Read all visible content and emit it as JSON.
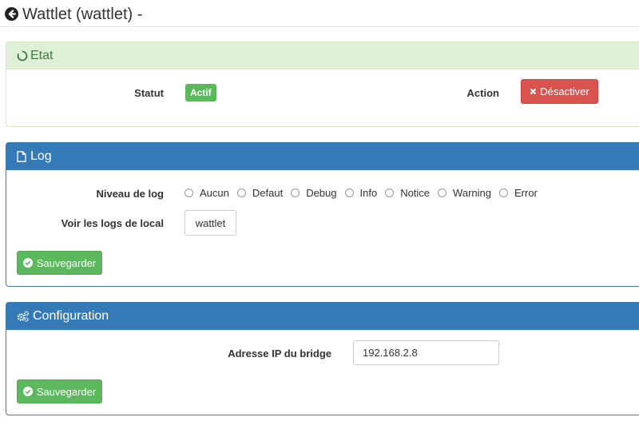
{
  "header": {
    "title": "Wattlet (wattlet) -",
    "back_icon": "arrow-circle-left-icon"
  },
  "etat": {
    "title": "Etat",
    "icon": "refresh-circle-icon",
    "statut_label": "Statut",
    "statut_value": "Actif",
    "action_label": "Action",
    "action_button": "Désactiver",
    "colors": {
      "heading_bg": "#dff0d8",
      "badge": "#5cb85c",
      "danger": "#d9534f"
    }
  },
  "log": {
    "title": "Log",
    "icon": "file-icon",
    "level_label": "Niveau de log",
    "levels": [
      "Aucun",
      "Defaut",
      "Debug",
      "Info",
      "Notice",
      "Warning",
      "Error"
    ],
    "view_label": "Voir les logs de local",
    "view_button": "wattlet",
    "save_button": "Sauvegarder"
  },
  "config": {
    "title": "Configuration",
    "icon": "gears-icon",
    "bridge_label": "Adresse IP du bridge",
    "bridge_value": "192.168.2.8",
    "save_button": "Sauvegarder"
  },
  "colors": {
    "primary": "#337ab7",
    "success": "#5cb85c"
  }
}
